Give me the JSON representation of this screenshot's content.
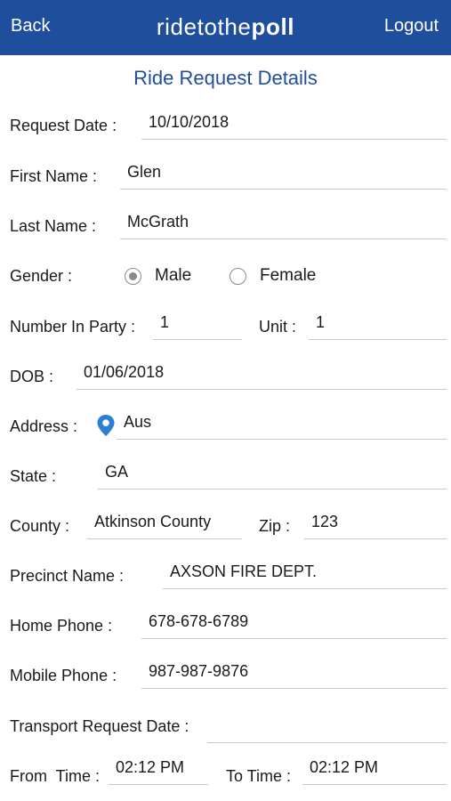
{
  "navbar": {
    "back_label": "Back",
    "logout_label": "Logout",
    "brand_light": "ridetothe",
    "brand_bold": "poll"
  },
  "page_title": "Ride Request Details",
  "fields": {
    "request_date": {
      "label": "Request Date :",
      "value": "10/10/2018"
    },
    "first_name": {
      "label": "First Name :",
      "value": "Glen"
    },
    "last_name": {
      "label": "Last Name :",
      "value": "McGrath"
    },
    "gender": {
      "label": "Gender :",
      "options": [
        "Male",
        "Female"
      ],
      "selected": "Male"
    },
    "number_in_party": {
      "label": "Number In Party :",
      "value": "1"
    },
    "unit": {
      "label": "Unit :",
      "value": "1"
    },
    "dob": {
      "label": "DOB :",
      "value": "01/06/2018"
    },
    "address": {
      "label": "Address :",
      "value": "Aus",
      "icon": "location-pin-icon"
    },
    "state": {
      "label": "State :",
      "value": "GA"
    },
    "county": {
      "label": "County :",
      "value": "Atkinson County"
    },
    "zip": {
      "label": "Zip :",
      "value": "123"
    },
    "precinct_name": {
      "label": "Precinct Name :",
      "value": "AXSON FIRE DEPT."
    },
    "home_phone": {
      "label": "Home Phone :",
      "value": "678-678-6789"
    },
    "mobile_phone": {
      "label": "Mobile Phone :",
      "value": "987-987-9876"
    },
    "transport_request_date": {
      "label": "Transport Request Date :",
      "value": ""
    },
    "from_time": {
      "label": "From  Time :",
      "value": "02:12 PM"
    },
    "to_time": {
      "label": "To Time :",
      "value": "02:12 PM"
    }
  },
  "colors": {
    "navbar_bg": "#1f4e9c",
    "title_color": "#1f4e9c",
    "pin_color": "#2a7fd4",
    "underline": "#c8c8c8"
  }
}
